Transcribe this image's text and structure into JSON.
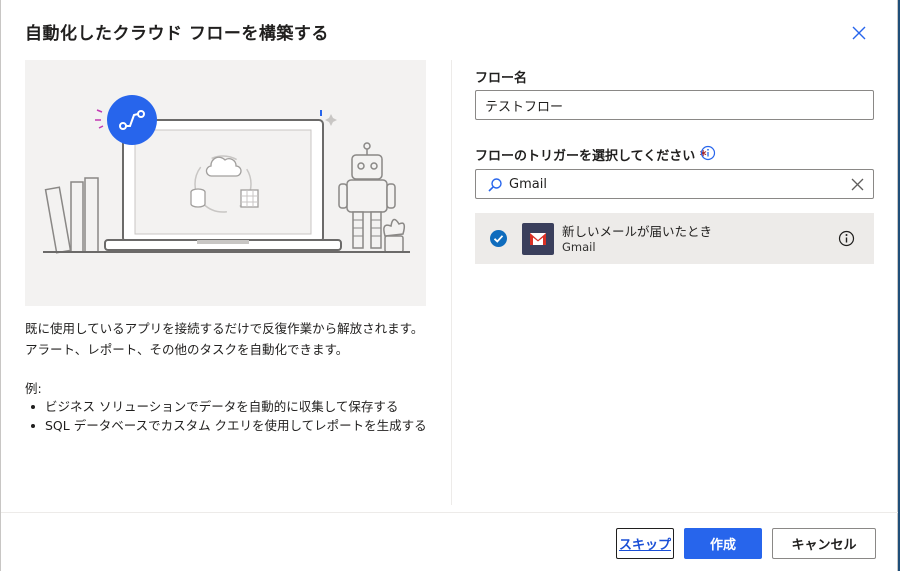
{
  "dialog": {
    "title": "自動化したクラウド フローを構築する",
    "description": "既に使用しているアプリを接続するだけで反復作業から解放されます。アラート、レポート、その他のタスクを自動化できます。",
    "examples_label": "例:",
    "examples": [
      "ビジネス ソリューションでデータを自動的に収集して保存する",
      "SQL データベースでカスタム クエリを使用してレポートを生成する"
    ]
  },
  "form": {
    "flow_name_label": "フロー名",
    "flow_name_value": "テストフロー",
    "trigger_label": "フローのトリガーを選択してください",
    "required_mark": "*",
    "search_value": "Gmail"
  },
  "trigger_result": {
    "name": "新しいメールが届いたとき",
    "connector": "Gmail"
  },
  "buttons": {
    "skip": "スキップ",
    "create": "作成",
    "cancel": "キャンセル"
  },
  "colors": {
    "accent": "#2765ec",
    "illustration_bg": "#f3f2f1",
    "selected_row": "#edebe9",
    "gmail_tile": "#3a3f5c"
  },
  "icons": [
    "close-icon",
    "flow-icon",
    "cloud-icon",
    "database-icon",
    "table-icon",
    "robot-icon",
    "info-icon",
    "search-icon",
    "clear-icon",
    "check-icon",
    "gmail-icon"
  ]
}
